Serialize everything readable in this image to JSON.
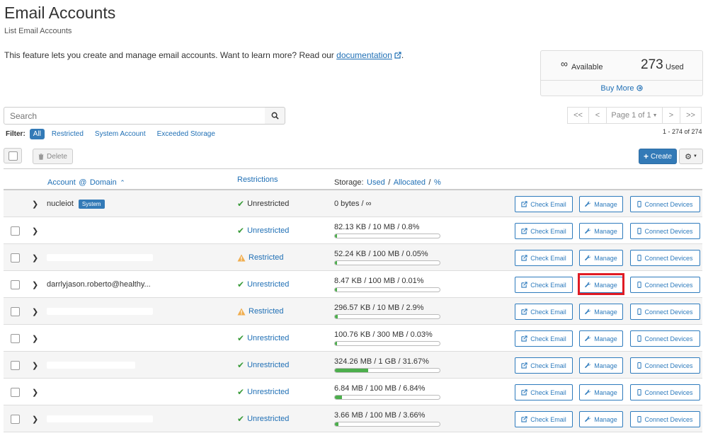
{
  "header": {
    "title": "Email Accounts",
    "subtitle": "List Email Accounts",
    "intro": "This feature lets you create and manage email accounts. Want to learn more? Read our",
    "intro_link": "documentation",
    "intro_end": "."
  },
  "stats": {
    "available_symbol": "∞",
    "available_label": "Available",
    "used_count": "273",
    "used_label": "Used",
    "buy_more": "Buy More"
  },
  "search": {
    "placeholder": "Search"
  },
  "pager": {
    "first": "<<",
    "prev": "<",
    "page_label": "Page 1 of 1",
    "next": ">",
    "last": ">>",
    "range": "1 - 274 of 274"
  },
  "filter": {
    "label": "Filter:",
    "options": [
      "All",
      "Restricted",
      "System Account",
      "Exceeded Storage"
    ]
  },
  "toolbar": {
    "delete": "Delete",
    "create": "Create"
  },
  "table": {
    "col_account": "Account",
    "col_at": "@",
    "col_domain": "Domain",
    "col_restrictions": "Restrictions",
    "col_storage": "Storage:",
    "col_used": "Used",
    "col_allocated": "Allocated",
    "col_percent": "%",
    "sep": "/",
    "rows": [
      {
        "account": "nucleiot",
        "badge": "System",
        "restriction": "Unrestricted",
        "status": "ok",
        "storage": "0 bytes / ∞",
        "usage": null
      },
      {
        "account": "",
        "restriction": "Unrestricted",
        "status": "ok",
        "storage": "82.13 KB / 10 MB / 0.8%",
        "usage": 0.008
      },
      {
        "account": "",
        "restriction": "Restricted",
        "status": "warn",
        "storage": "52.24 KB / 100 MB / 0.05%",
        "usage": 0.0005
      },
      {
        "account": "darrlyjason.roberto@healthy...",
        "restriction": "Unrestricted",
        "status": "ok",
        "storage": "8.47 KB / 100 MB / 0.01%",
        "usage": 0.0001
      },
      {
        "account": "",
        "restriction": "Restricted",
        "status": "warn",
        "storage": "296.57 KB / 10 MB / 2.9%",
        "usage": 0.029
      },
      {
        "account": "",
        "restriction": "Unrestricted",
        "status": "ok",
        "storage": "100.76 KB / 300 MB / 0.03%",
        "usage": 0.0003
      },
      {
        "account": "",
        "restriction": "Unrestricted",
        "status": "ok",
        "storage": "324.26 MB / 1 GB / 31.67%",
        "usage": 0.3167
      },
      {
        "account": "",
        "restriction": "Unrestricted",
        "status": "ok",
        "storage": "6.84 MB / 100 MB / 6.84%",
        "usage": 0.0684
      },
      {
        "account": "",
        "restriction": "Unrestricted",
        "status": "ok",
        "storage": "3.66 MB / 100 MB / 3.66%",
        "usage": 0.0366
      }
    ],
    "actions": {
      "check_email": "Check Email",
      "manage": "Manage",
      "connect": "Connect Devices"
    }
  },
  "colors": {
    "accent": "#337ab7",
    "link": "#1f6fb5",
    "success": "#4cae4c",
    "warning": "#f0ad4e",
    "highlight": "#e01b24"
  }
}
